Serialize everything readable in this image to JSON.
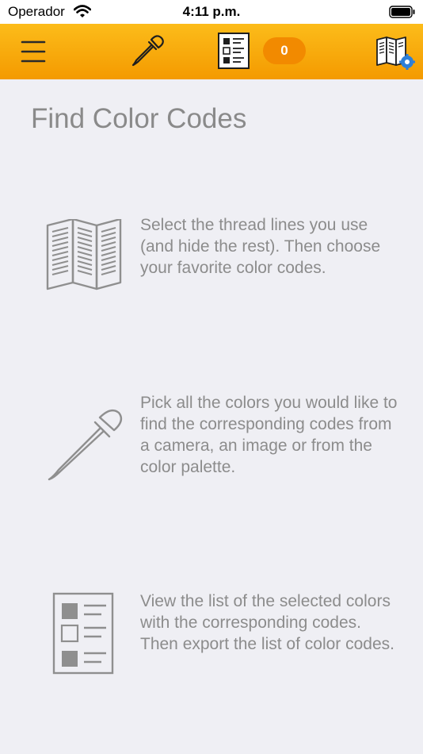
{
  "status_bar": {
    "carrier": "Operador",
    "time": "4:11 p.m."
  },
  "toolbar": {
    "selected_count": "0",
    "icons": [
      "menu-icon",
      "eyedropper-icon",
      "color-list-icon",
      "catalog-settings-icon"
    ],
    "accent_top": "#fcbc1a",
    "accent_bottom": "#f49a00",
    "badge_color": "#f28a00"
  },
  "main": {
    "title": "Find Color Codes",
    "features": [
      {
        "icon": "open-catalog-icon",
        "text": "Select the thread lines you use (and hide the rest). Then choose your favorite color codes."
      },
      {
        "icon": "eyedropper-icon",
        "text": "Pick all the colors you would like to find the corresponding codes from a camera, an image or from the color palette."
      },
      {
        "icon": "color-list-icon",
        "text": "View the list of the selected colors with the corresponding codes. Then export the list of color codes."
      }
    ]
  }
}
